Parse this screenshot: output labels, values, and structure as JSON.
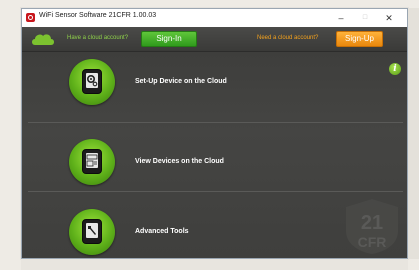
{
  "window": {
    "title": "WiFi Sensor Software 21CFR 1.00.03",
    "controls": {
      "minimize": "–",
      "maximize": "□",
      "close": "✕"
    }
  },
  "account_bar": {
    "have_account_text": "Have a cloud account?",
    "signin_label": "Sign-In",
    "need_account_text": "Need a cloud account?",
    "signup_label": "Sign-Up"
  },
  "menu": [
    {
      "label": "Set-Up Device on the Cloud",
      "icon": "gear-device-icon"
    },
    {
      "label": "View Devices on the Cloud",
      "icon": "display-device-icon"
    },
    {
      "label": "Advanced Tools",
      "icon": "wrench-device-icon"
    }
  ],
  "info": {
    "glyph": "i"
  },
  "watermark": {
    "line1": "21",
    "line2": "CFR"
  },
  "colors": {
    "green_accent": "#5fb11a",
    "orange_accent": "#f4a21d",
    "background_dark": "#424240"
  }
}
